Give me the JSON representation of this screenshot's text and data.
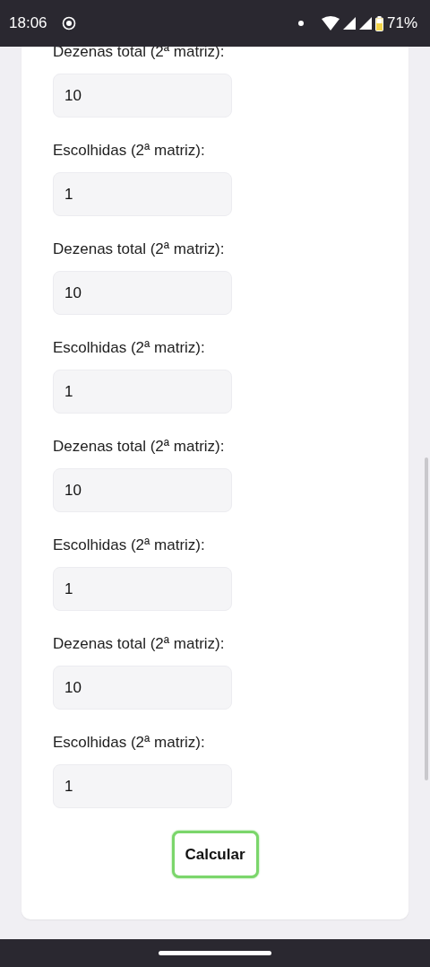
{
  "status_bar": {
    "time": "18:06",
    "battery": "71%"
  },
  "fields": [
    {
      "label": "Dezenas total (2ª matriz):",
      "value": "10"
    },
    {
      "label": "Escolhidas (2ª matriz):",
      "value": "1"
    },
    {
      "label": "Dezenas total (2ª matriz):",
      "value": "10"
    },
    {
      "label": "Escolhidas (2ª matriz):",
      "value": "1"
    },
    {
      "label": "Dezenas total (2ª matriz):",
      "value": "10"
    },
    {
      "label": "Escolhidas (2ª matriz):",
      "value": "1"
    },
    {
      "label": "Dezenas total (2ª matriz):",
      "value": "10"
    },
    {
      "label": "Escolhidas (2ª matriz):",
      "value": "1"
    }
  ],
  "button": {
    "label": "Calcular"
  }
}
